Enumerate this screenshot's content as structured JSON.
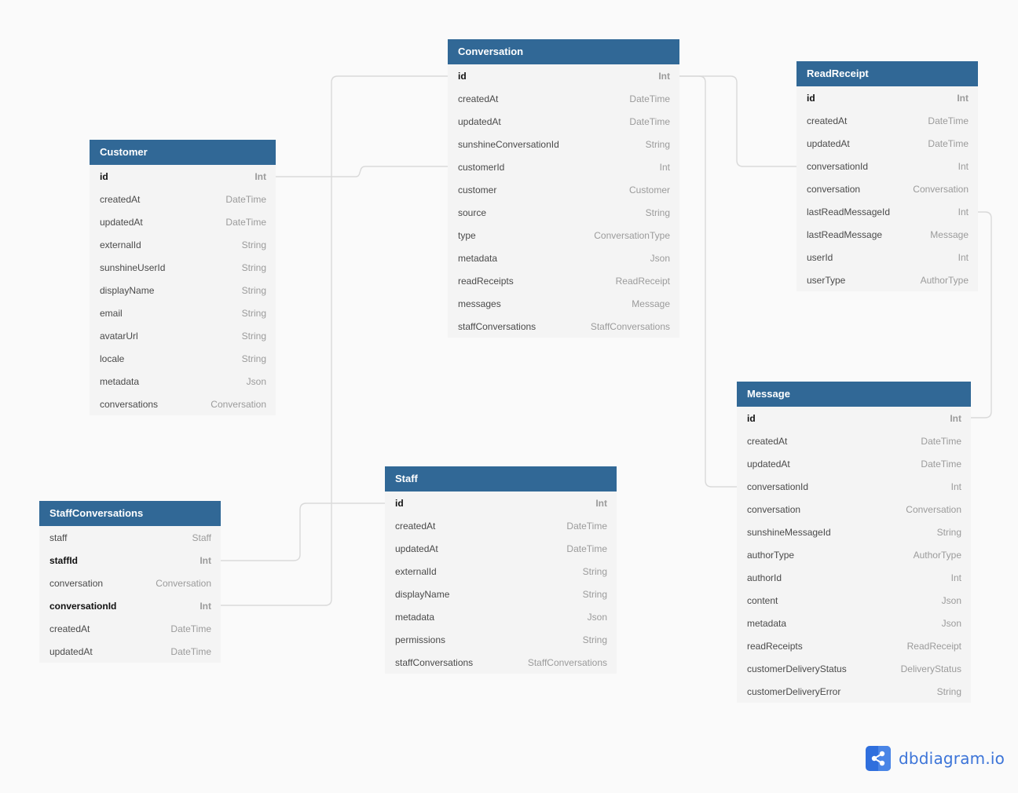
{
  "tables": {
    "conversation": {
      "name": "Conversation",
      "fields": [
        {
          "name": "id",
          "type": "Int",
          "pk": true
        },
        {
          "name": "createdAt",
          "type": "DateTime"
        },
        {
          "name": "updatedAt",
          "type": "DateTime"
        },
        {
          "name": "sunshineConversationId",
          "type": "String"
        },
        {
          "name": "customerId",
          "type": "Int"
        },
        {
          "name": "customer",
          "type": "Customer"
        },
        {
          "name": "source",
          "type": "String"
        },
        {
          "name": "type",
          "type": "ConversationType"
        },
        {
          "name": "metadata",
          "type": "Json"
        },
        {
          "name": "readReceipts",
          "type": "ReadReceipt"
        },
        {
          "name": "messages",
          "type": "Message"
        },
        {
          "name": "staffConversations",
          "type": "StaffConversations"
        }
      ]
    },
    "readReceipt": {
      "name": "ReadReceipt",
      "fields": [
        {
          "name": "id",
          "type": "Int",
          "pk": true
        },
        {
          "name": "createdAt",
          "type": "DateTime"
        },
        {
          "name": "updatedAt",
          "type": "DateTime"
        },
        {
          "name": "conversationId",
          "type": "Int"
        },
        {
          "name": "conversation",
          "type": "Conversation"
        },
        {
          "name": "lastReadMessageId",
          "type": "Int"
        },
        {
          "name": "lastReadMessage",
          "type": "Message"
        },
        {
          "name": "userId",
          "type": "Int"
        },
        {
          "name": "userType",
          "type": "AuthorType"
        }
      ]
    },
    "customer": {
      "name": "Customer",
      "fields": [
        {
          "name": "id",
          "type": "Int",
          "pk": true
        },
        {
          "name": "createdAt",
          "type": "DateTime"
        },
        {
          "name": "updatedAt",
          "type": "DateTime"
        },
        {
          "name": "externalId",
          "type": "String"
        },
        {
          "name": "sunshineUserId",
          "type": "String"
        },
        {
          "name": "displayName",
          "type": "String"
        },
        {
          "name": "email",
          "type": "String"
        },
        {
          "name": "avatarUrl",
          "type": "String"
        },
        {
          "name": "locale",
          "type": "String"
        },
        {
          "name": "metadata",
          "type": "Json"
        },
        {
          "name": "conversations",
          "type": "Conversation"
        }
      ]
    },
    "message": {
      "name": "Message",
      "fields": [
        {
          "name": "id",
          "type": "Int",
          "pk": true
        },
        {
          "name": "createdAt",
          "type": "DateTime"
        },
        {
          "name": "updatedAt",
          "type": "DateTime"
        },
        {
          "name": "conversationId",
          "type": "Int"
        },
        {
          "name": "conversation",
          "type": "Conversation"
        },
        {
          "name": "sunshineMessageId",
          "type": "String"
        },
        {
          "name": "authorType",
          "type": "AuthorType"
        },
        {
          "name": "authorId",
          "type": "Int"
        },
        {
          "name": "content",
          "type": "Json"
        },
        {
          "name": "metadata",
          "type": "Json"
        },
        {
          "name": "readReceipts",
          "type": "ReadReceipt"
        },
        {
          "name": "customerDeliveryStatus",
          "type": "DeliveryStatus"
        },
        {
          "name": "customerDeliveryError",
          "type": "String"
        }
      ]
    },
    "staff": {
      "name": "Staff",
      "fields": [
        {
          "name": "id",
          "type": "Int",
          "pk": true
        },
        {
          "name": "createdAt",
          "type": "DateTime"
        },
        {
          "name": "updatedAt",
          "type": "DateTime"
        },
        {
          "name": "externalId",
          "type": "String"
        },
        {
          "name": "displayName",
          "type": "String"
        },
        {
          "name": "metadata",
          "type": "Json"
        },
        {
          "name": "permissions",
          "type": "String"
        },
        {
          "name": "staffConversations",
          "type": "StaffConversations"
        }
      ]
    },
    "staffConversations": {
      "name": "StaffConversations",
      "fields": [
        {
          "name": "staff",
          "type": "Staff"
        },
        {
          "name": "staffId",
          "type": "Int",
          "pk": true
        },
        {
          "name": "conversation",
          "type": "Conversation"
        },
        {
          "name": "conversationId",
          "type": "Int",
          "pk": true
        },
        {
          "name": "createdAt",
          "type": "DateTime"
        },
        {
          "name": "updatedAt",
          "type": "DateTime"
        }
      ]
    }
  },
  "relationships": [
    {
      "from": "Customer.id",
      "to": "Conversation.customerId"
    },
    {
      "from": "Conversation.id",
      "to": "ReadReceipt.conversationId"
    },
    {
      "from": "Conversation.id",
      "to": "Message.conversationId"
    },
    {
      "from": "Conversation.id",
      "to": "StaffConversations.conversationId"
    },
    {
      "from": "Staff.id",
      "to": "StaffConversations.staffId"
    },
    {
      "from": "Message.id",
      "to": "ReadReceipt.lastReadMessageId"
    }
  ],
  "branding": {
    "logo_text": "dbdiagram.io",
    "logo_icon": "share-nodes-icon",
    "header_color": "#316896",
    "brand_color": "#2f6fdd"
  }
}
